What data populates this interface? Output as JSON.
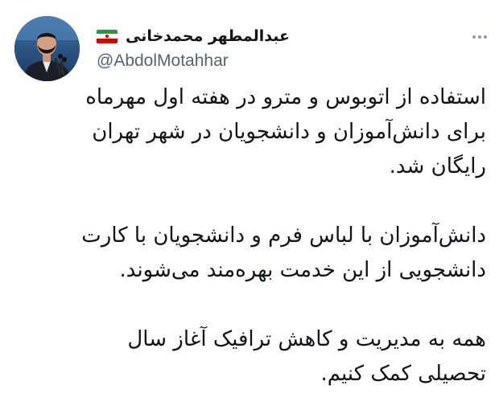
{
  "author": {
    "display_name": "عبدالمطهر محمدخانی",
    "handle": "@AbdolMotahhar",
    "flag": "iran-flag-icon",
    "flag_colors": {
      "green": "#239f40",
      "white": "#ffffff",
      "red": "#da0000"
    }
  },
  "tweet": {
    "paragraphs": [
      {
        "lines": [
          "استفاده از اتوبوس و مترو در هفته اول مهرماه",
          "برای دانش‌آموزان و دانشجویان در شهر تهران",
          "رایگان شد."
        ]
      },
      {
        "lines": [
          "دانش‌آموزان با لباس فرم و دانشجویان با کارت",
          "دانشجویی از این خدمت بهره‌مند می‌شوند."
        ]
      },
      {
        "lines": [
          "همه به مدیریت و کاهش ترافیک آغاز سال",
          "تحصیلی کمک کنیم."
        ]
      }
    ]
  },
  "icons": {
    "more": "more-options-icon",
    "avatar": "profile-avatar"
  },
  "colors": {
    "text": "#0f1419",
    "secondary_text": "#536471",
    "background": "#ffffff"
  }
}
